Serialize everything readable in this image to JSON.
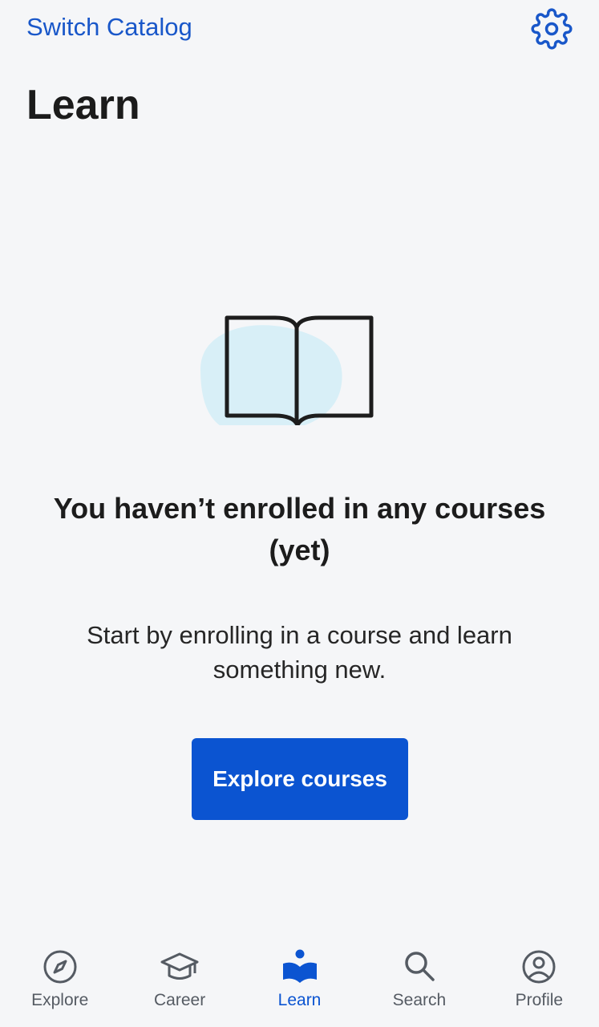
{
  "header": {
    "switch_catalog_label": "Switch Catalog",
    "settings_icon": "gear-icon"
  },
  "page": {
    "title": "Learn"
  },
  "empty_state": {
    "illustration_icon": "open-book-icon",
    "heading": "You haven’t enrolled in any courses (yet)",
    "description": "Start by enrolling in a course and learn something new.",
    "button_label": "Explore courses"
  },
  "bottom_nav": {
    "active": "Learn",
    "items": [
      {
        "label": "Explore",
        "icon": "compass-icon"
      },
      {
        "label": "Career",
        "icon": "graduation-cap-icon"
      },
      {
        "label": "Learn",
        "icon": "book-reader-icon"
      },
      {
        "label": "Search",
        "icon": "search-icon"
      },
      {
        "label": "Profile",
        "icon": "profile-icon"
      }
    ]
  },
  "colors": {
    "accent": "#0b54d1",
    "link": "#1957c9",
    "background": "#f5f6f8",
    "illustration_blob": "#d8eff7",
    "nav_inactive": "#555b63",
    "text": "#1c1c1c"
  }
}
